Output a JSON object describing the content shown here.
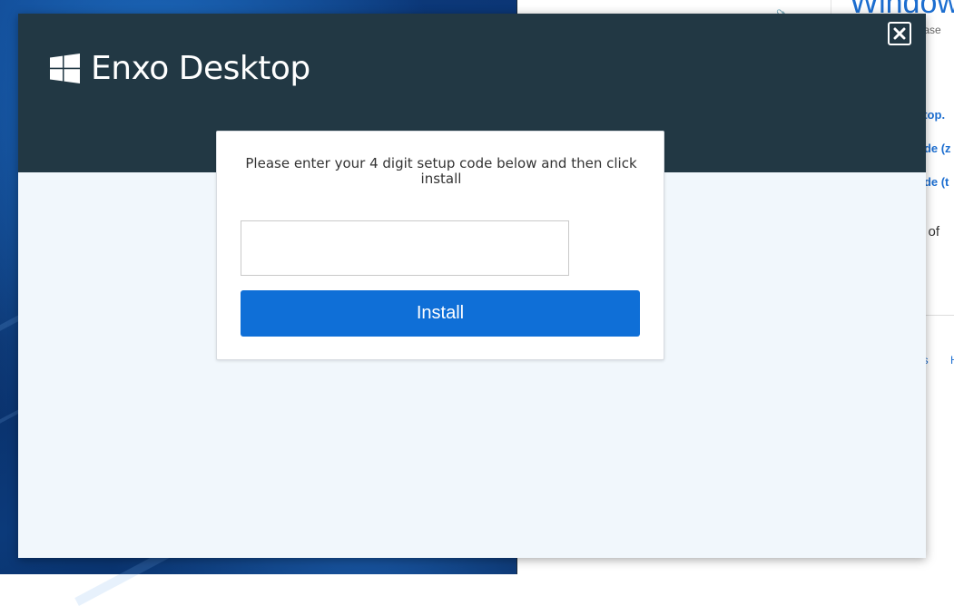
{
  "app": {
    "name": "Enxo Desktop"
  },
  "setup": {
    "instructions": "Please enter your 4 digit setup code below and then click install",
    "code_value": "",
    "code_placeholder": "",
    "install_label": "Install"
  },
  "background_page": {
    "title": "Window",
    "subtitle": "Please",
    "links": [
      "ktop.",
      "ode (z",
      "ode (t"
    ],
    "text": "e of",
    "footer_links": [
      "us",
      "H"
    ]
  },
  "colors": {
    "header_bg": "#223844",
    "modal_body_bg": "#f1f7fc",
    "install_button": "#0f6fd7",
    "link": "#1c6ed0"
  },
  "icons": {
    "brand": "windows-logo-icon",
    "close": "close-icon"
  }
}
